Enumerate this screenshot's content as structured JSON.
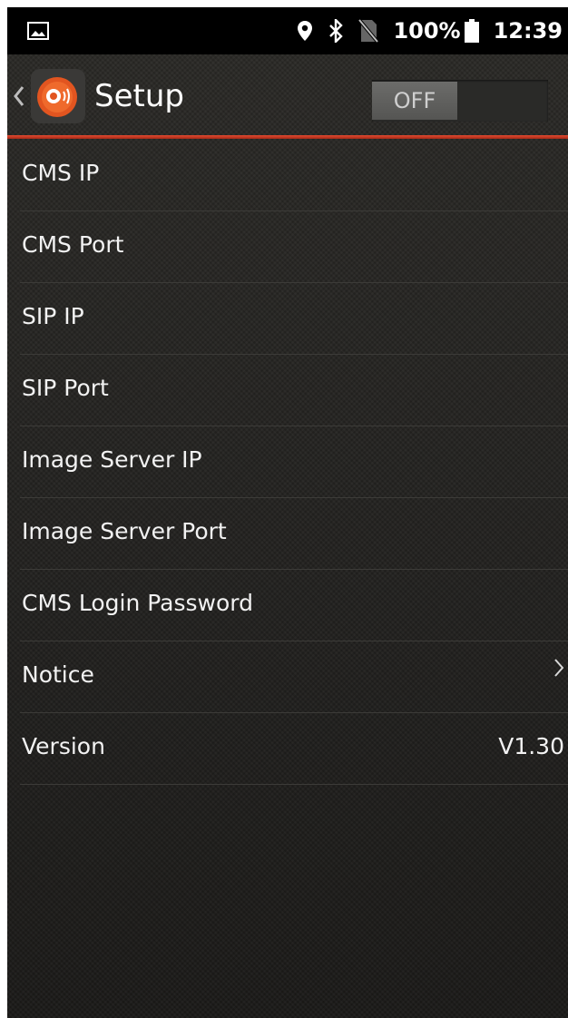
{
  "status_bar": {
    "battery": "100%",
    "time": "12:39",
    "icons": [
      "image-icon",
      "location-icon",
      "bluetooth-icon",
      "no-sim-icon",
      "battery-icon"
    ]
  },
  "app_bar": {
    "title": "Setup",
    "toggle_label": "OFF",
    "accent_color": "#c6351f"
  },
  "settings": {
    "items": [
      {
        "label": "CMS IP"
      },
      {
        "label": "CMS Port"
      },
      {
        "label": "SIP IP"
      },
      {
        "label": "SIP Port"
      },
      {
        "label": "Image Server IP"
      },
      {
        "label": "Image Server Port"
      },
      {
        "label": "CMS Login Password"
      },
      {
        "label": "Notice"
      },
      {
        "label": "Version",
        "value": "V1.30"
      }
    ]
  }
}
